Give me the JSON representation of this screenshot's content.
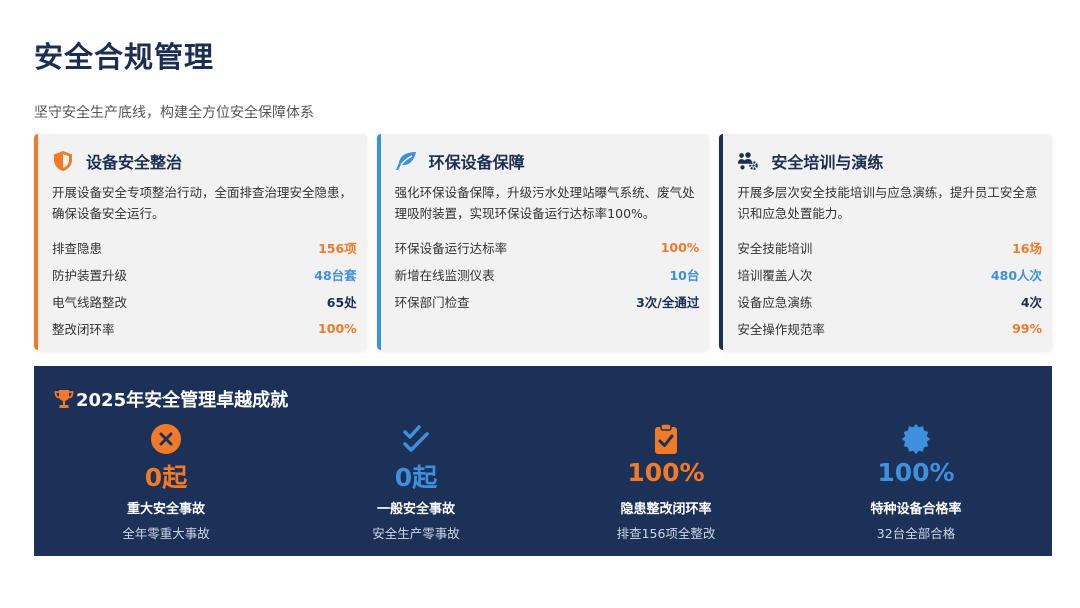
{
  "page": {
    "title": "安全合规管理",
    "subtitle": "坚守安全生产底线，构建全方位安全保障体系"
  },
  "colors": {
    "orange": "#f07a28",
    "blue": "#3e8fdc",
    "navy": "#1c2f52"
  },
  "cards": [
    {
      "icon": "shield-icon",
      "title": "设备安全整治",
      "desc": "开展设备安全专项整治行动，全面排查治理安全隐患，确保设备安全运行。",
      "stats": [
        {
          "label": "排查隐患",
          "value": "156项",
          "color": "orange"
        },
        {
          "label": "防护装置升级",
          "value": "48台套",
          "color": "blue"
        },
        {
          "label": "电气线路整改",
          "value": "65处",
          "color": "dark"
        },
        {
          "label": "整改闭环率",
          "value": "100%",
          "color": "orange"
        }
      ]
    },
    {
      "icon": "leaf-icon",
      "title": "环保设备保障",
      "desc": "强化环保设备保障，升级污水处理站曝气系统、废气处理吸附装置，实现环保设备运行达标率100%。",
      "stats": [
        {
          "label": "环保设备运行达标率",
          "value": "100%",
          "color": "orange"
        },
        {
          "label": "新增在线监测仪表",
          "value": "10台",
          "color": "blue"
        },
        {
          "label": "环保部门检查",
          "value": "3次/全通过",
          "color": "dark"
        }
      ]
    },
    {
      "icon": "users-gear-icon",
      "title": "安全培训与演练",
      "desc": "开展多层次安全技能培训与应急演练，提升员工安全意识和应急处置能力。",
      "stats": [
        {
          "label": "安全技能培训",
          "value": "16场",
          "color": "orange"
        },
        {
          "label": "培训覆盖人次",
          "value": "480人次",
          "color": "blue"
        },
        {
          "label": "设备应急演练",
          "value": "4次",
          "color": "dark"
        },
        {
          "label": "安全操作规范率",
          "value": "99%",
          "color": "orange"
        }
      ]
    }
  ],
  "achievements": {
    "title": "2025年安全管理卓越成就",
    "icon": "trophy-icon",
    "items": [
      {
        "icon": "x-circle-icon",
        "value": "0起",
        "label": "重大安全事故",
        "sub": "全年零重大事故",
        "color": "#f07a28"
      },
      {
        "icon": "double-check-icon",
        "value": "0起",
        "label": "一般安全事故",
        "sub": "安全生产零事故",
        "color": "#3e8fdc"
      },
      {
        "icon": "clipboard-check-icon",
        "value": "100%",
        "label": "隐患整改闭环率",
        "sub": "排查156项全整改",
        "color": "#f07a28"
      },
      {
        "icon": "certificate-badge-icon",
        "value": "100%",
        "label": "特种设备合格率",
        "sub": "32台全部合格",
        "color": "#3e8fdc"
      }
    ]
  }
}
